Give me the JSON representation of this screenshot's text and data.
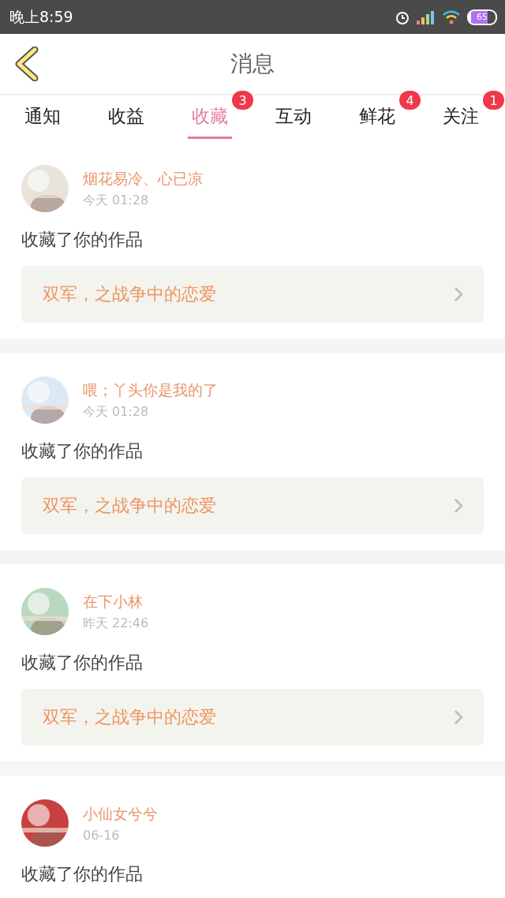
{
  "status_bar": {
    "time": "晚上8:59",
    "battery": "65"
  },
  "header": {
    "title": "消息"
  },
  "tabs": [
    {
      "label": "通知",
      "selected": false
    },
    {
      "label": "收益",
      "selected": false
    },
    {
      "label": "收藏",
      "selected": true,
      "badge": "3"
    },
    {
      "label": "互动",
      "selected": false
    },
    {
      "label": "鲜花",
      "selected": false,
      "badge": "4"
    },
    {
      "label": "关注",
      "selected": false,
      "badge": "1"
    }
  ],
  "messages": [
    {
      "name": "烟花易冷、心已凉",
      "time": "今天 01:28",
      "action": "收藏了你的作品",
      "work": "双军，之战争中的恋爱"
    },
    {
      "name": "喂；丫头你是我的了",
      "time": "今天 01:28",
      "action": "收藏了你的作品",
      "work": "双军，之战争中的恋爱"
    },
    {
      "name": "在下小林",
      "time": "昨天 22:46",
      "action": "收藏了你的作品",
      "work": "双军，之战争中的恋爱"
    },
    {
      "name": "小仙女兮兮",
      "time": "06-16",
      "action": "收藏了你的作品"
    }
  ]
}
